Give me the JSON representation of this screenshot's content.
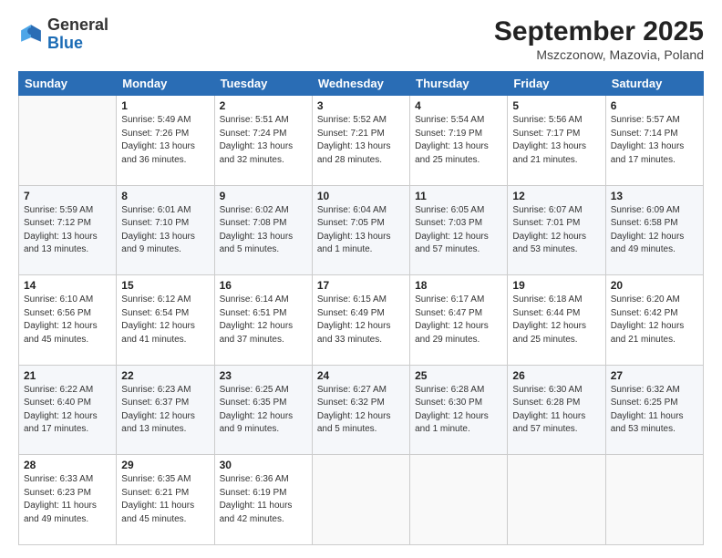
{
  "header": {
    "logo_general": "General",
    "logo_blue": "Blue",
    "month_title": "September 2025",
    "subtitle": "Mszczonow, Mazovia, Poland"
  },
  "weekdays": [
    "Sunday",
    "Monday",
    "Tuesday",
    "Wednesday",
    "Thursday",
    "Friday",
    "Saturday"
  ],
  "weeks": [
    [
      {
        "day": "",
        "info": ""
      },
      {
        "day": "1",
        "info": "Sunrise: 5:49 AM\nSunset: 7:26 PM\nDaylight: 13 hours\nand 36 minutes."
      },
      {
        "day": "2",
        "info": "Sunrise: 5:51 AM\nSunset: 7:24 PM\nDaylight: 13 hours\nand 32 minutes."
      },
      {
        "day": "3",
        "info": "Sunrise: 5:52 AM\nSunset: 7:21 PM\nDaylight: 13 hours\nand 28 minutes."
      },
      {
        "day": "4",
        "info": "Sunrise: 5:54 AM\nSunset: 7:19 PM\nDaylight: 13 hours\nand 25 minutes."
      },
      {
        "day": "5",
        "info": "Sunrise: 5:56 AM\nSunset: 7:17 PM\nDaylight: 13 hours\nand 21 minutes."
      },
      {
        "day": "6",
        "info": "Sunrise: 5:57 AM\nSunset: 7:14 PM\nDaylight: 13 hours\nand 17 minutes."
      }
    ],
    [
      {
        "day": "7",
        "info": "Sunrise: 5:59 AM\nSunset: 7:12 PM\nDaylight: 13 hours\nand 13 minutes."
      },
      {
        "day": "8",
        "info": "Sunrise: 6:01 AM\nSunset: 7:10 PM\nDaylight: 13 hours\nand 9 minutes."
      },
      {
        "day": "9",
        "info": "Sunrise: 6:02 AM\nSunset: 7:08 PM\nDaylight: 13 hours\nand 5 minutes."
      },
      {
        "day": "10",
        "info": "Sunrise: 6:04 AM\nSunset: 7:05 PM\nDaylight: 13 hours\nand 1 minute."
      },
      {
        "day": "11",
        "info": "Sunrise: 6:05 AM\nSunset: 7:03 PM\nDaylight: 12 hours\nand 57 minutes."
      },
      {
        "day": "12",
        "info": "Sunrise: 6:07 AM\nSunset: 7:01 PM\nDaylight: 12 hours\nand 53 minutes."
      },
      {
        "day": "13",
        "info": "Sunrise: 6:09 AM\nSunset: 6:58 PM\nDaylight: 12 hours\nand 49 minutes."
      }
    ],
    [
      {
        "day": "14",
        "info": "Sunrise: 6:10 AM\nSunset: 6:56 PM\nDaylight: 12 hours\nand 45 minutes."
      },
      {
        "day": "15",
        "info": "Sunrise: 6:12 AM\nSunset: 6:54 PM\nDaylight: 12 hours\nand 41 minutes."
      },
      {
        "day": "16",
        "info": "Sunrise: 6:14 AM\nSunset: 6:51 PM\nDaylight: 12 hours\nand 37 minutes."
      },
      {
        "day": "17",
        "info": "Sunrise: 6:15 AM\nSunset: 6:49 PM\nDaylight: 12 hours\nand 33 minutes."
      },
      {
        "day": "18",
        "info": "Sunrise: 6:17 AM\nSunset: 6:47 PM\nDaylight: 12 hours\nand 29 minutes."
      },
      {
        "day": "19",
        "info": "Sunrise: 6:18 AM\nSunset: 6:44 PM\nDaylight: 12 hours\nand 25 minutes."
      },
      {
        "day": "20",
        "info": "Sunrise: 6:20 AM\nSunset: 6:42 PM\nDaylight: 12 hours\nand 21 minutes."
      }
    ],
    [
      {
        "day": "21",
        "info": "Sunrise: 6:22 AM\nSunset: 6:40 PM\nDaylight: 12 hours\nand 17 minutes."
      },
      {
        "day": "22",
        "info": "Sunrise: 6:23 AM\nSunset: 6:37 PM\nDaylight: 12 hours\nand 13 minutes."
      },
      {
        "day": "23",
        "info": "Sunrise: 6:25 AM\nSunset: 6:35 PM\nDaylight: 12 hours\nand 9 minutes."
      },
      {
        "day": "24",
        "info": "Sunrise: 6:27 AM\nSunset: 6:32 PM\nDaylight: 12 hours\nand 5 minutes."
      },
      {
        "day": "25",
        "info": "Sunrise: 6:28 AM\nSunset: 6:30 PM\nDaylight: 12 hours\nand 1 minute."
      },
      {
        "day": "26",
        "info": "Sunrise: 6:30 AM\nSunset: 6:28 PM\nDaylight: 11 hours\nand 57 minutes."
      },
      {
        "day": "27",
        "info": "Sunrise: 6:32 AM\nSunset: 6:25 PM\nDaylight: 11 hours\nand 53 minutes."
      }
    ],
    [
      {
        "day": "28",
        "info": "Sunrise: 6:33 AM\nSunset: 6:23 PM\nDaylight: 11 hours\nand 49 minutes."
      },
      {
        "day": "29",
        "info": "Sunrise: 6:35 AM\nSunset: 6:21 PM\nDaylight: 11 hours\nand 45 minutes."
      },
      {
        "day": "30",
        "info": "Sunrise: 6:36 AM\nSunset: 6:19 PM\nDaylight: 11 hours\nand 42 minutes."
      },
      {
        "day": "",
        "info": ""
      },
      {
        "day": "",
        "info": ""
      },
      {
        "day": "",
        "info": ""
      },
      {
        "day": "",
        "info": ""
      }
    ]
  ]
}
